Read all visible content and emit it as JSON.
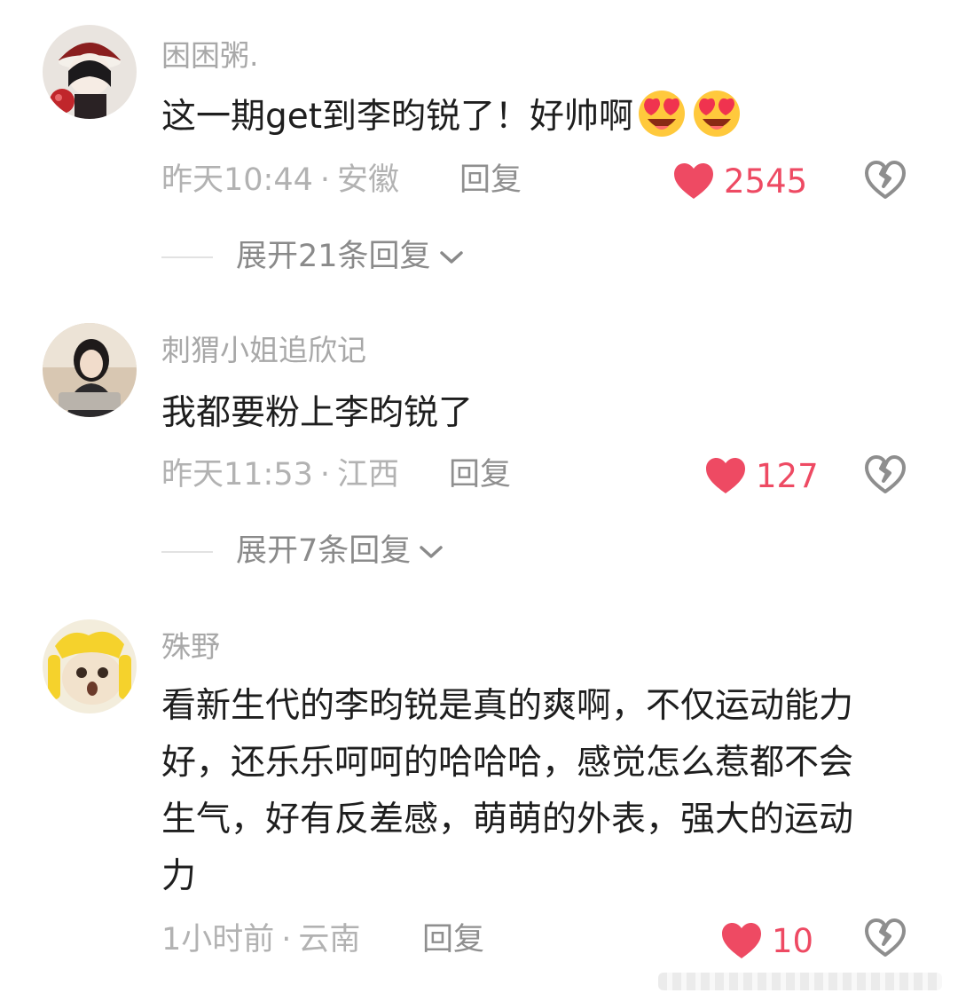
{
  "comments": [
    {
      "username": "困困粥.",
      "text": "这一期get到李昀锐了！好帅啊",
      "emoji": [
        "heart-eyes-emoji",
        "heart-eyes-emoji"
      ],
      "time": "昨天10:44",
      "separator": "·",
      "location": "安徽",
      "reply_label": "回复",
      "likes": "2545",
      "expand_label": "展开21条回复"
    },
    {
      "username": "刺猬小姐追欣记",
      "text": "我都要粉上李昀锐了",
      "time": "昨天11:53",
      "separator": "·",
      "location": "江西",
      "reply_label": "回复",
      "likes": "127",
      "expand_label": "展开7条回复"
    },
    {
      "username": "殊野",
      "text": "看新生代的李昀锐是真的爽啊，不仅运动能力好，还乐乐呵呵的哈哈哈，感觉怎么惹都不会生气，好有反差感，萌萌的外表，强大的运动力",
      "time": "1小时前",
      "separator": "·",
      "location": "云南",
      "reply_label": "回复",
      "likes": "10"
    }
  ],
  "colors": {
    "like_red": "#ee4a63",
    "meta_gray": "#b2b2b2",
    "username_gray": "#a8a8a8"
  },
  "icons": {
    "like": "heart-icon",
    "dislike": "broken-heart-icon",
    "expand": "chevron-down-icon"
  }
}
